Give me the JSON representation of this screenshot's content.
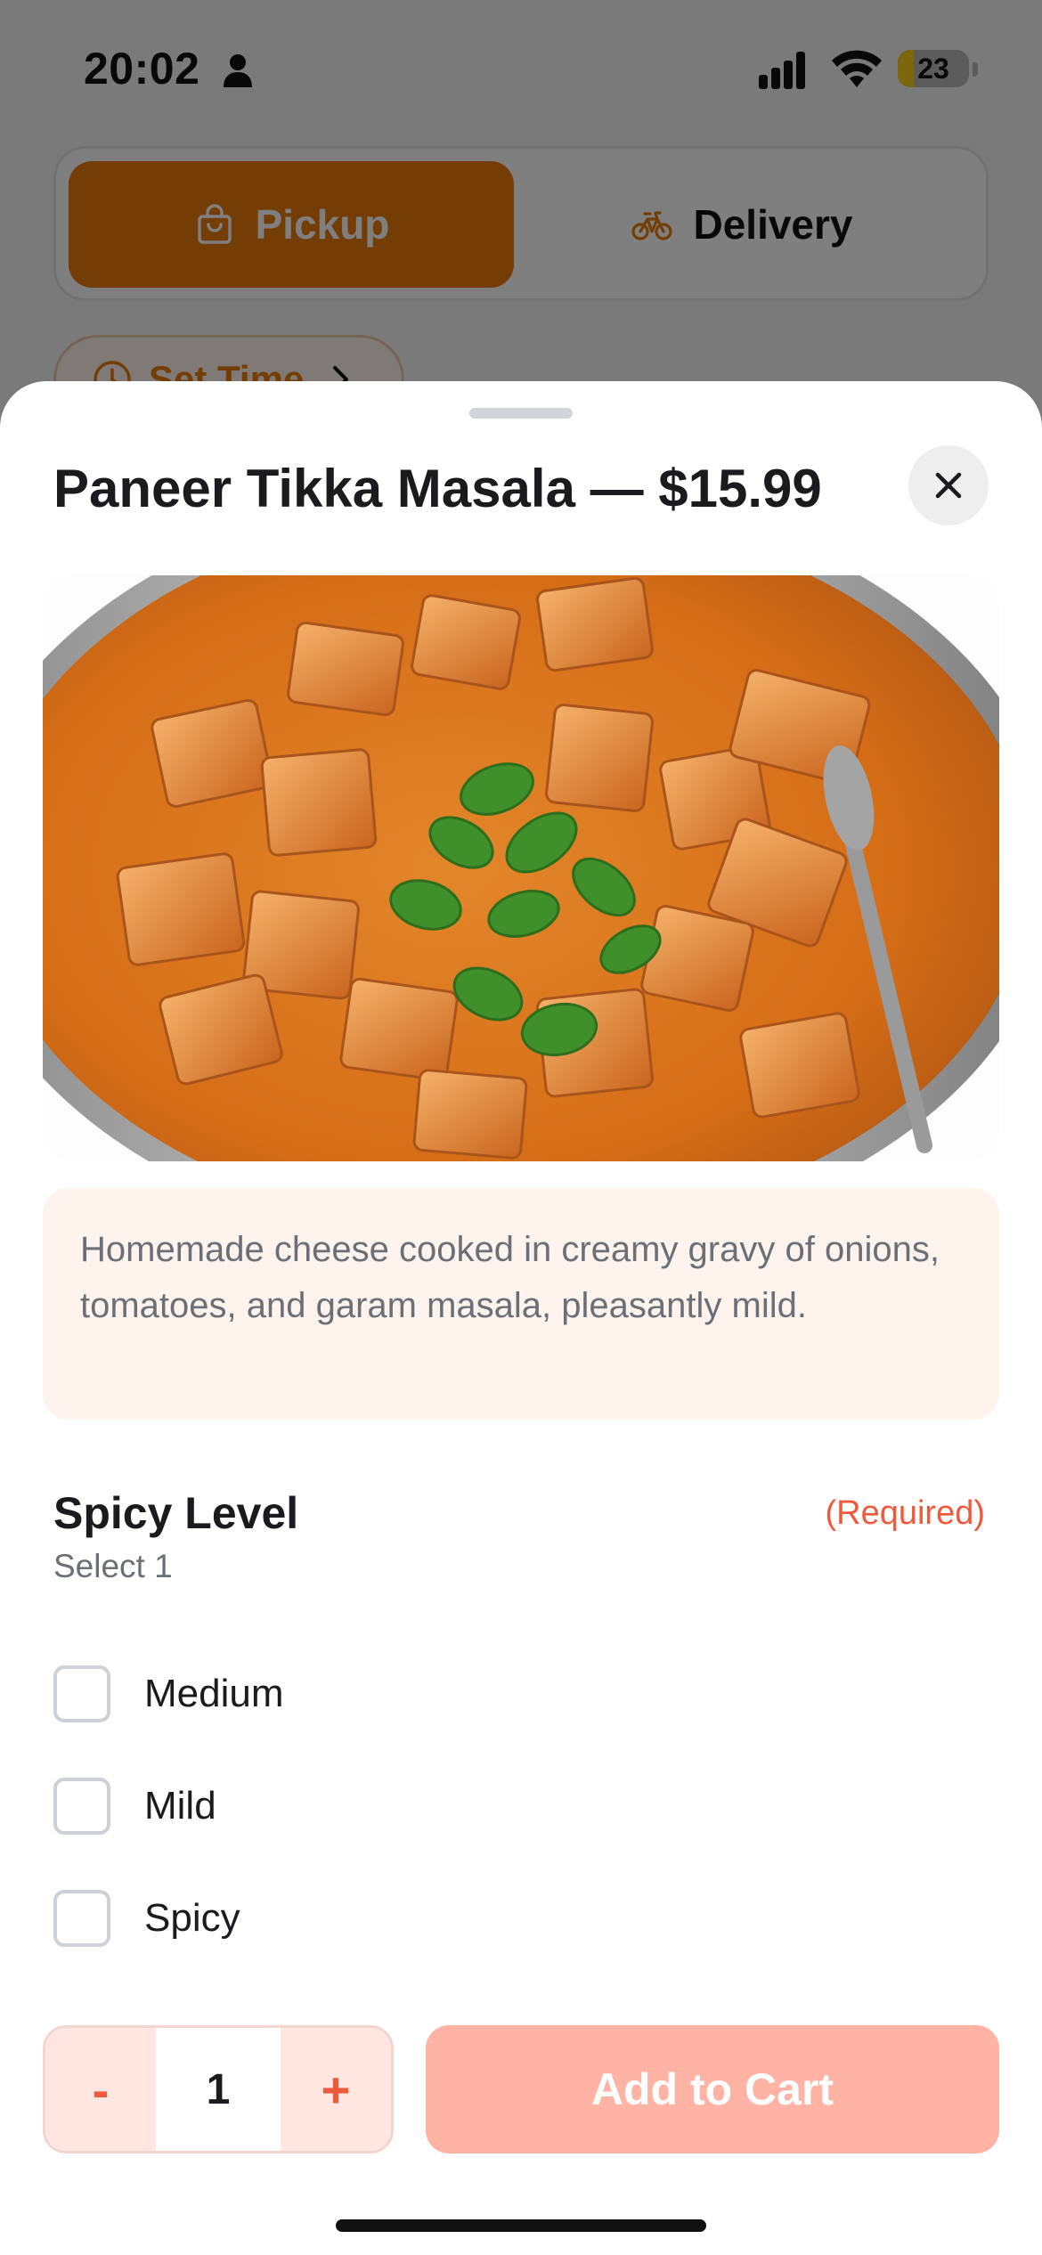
{
  "status_bar": {
    "time": "20:02",
    "battery_level": "23",
    "battery_fraction": 0.23
  },
  "order_mode": {
    "pickup_label": "Pickup",
    "delivery_label": "Delivery",
    "selected": "Pickup"
  },
  "set_time": {
    "label": "Set Time"
  },
  "item": {
    "title": "Paneer Tikka Masala — $15.99",
    "description": "Homemade cheese cooked in creamy gravy of onions, tomatoes, and garam masala, pleasantly mild."
  },
  "option_group": {
    "title": "Spicy Level",
    "required_label": "(Required)",
    "hint": "Select 1",
    "options": [
      {
        "label": "Medium",
        "checked": false
      },
      {
        "label": "Mild",
        "checked": false
      },
      {
        "label": "Spicy",
        "checked": false
      }
    ]
  },
  "footer": {
    "decrement_label": "-",
    "quantity": "1",
    "increment_label": "+",
    "add_to_cart_label": "Add to Cart"
  },
  "colors": {
    "accent_orange": "#e97a0d",
    "required_red": "#ef5a3c",
    "add_to_cart_disabled": "#ffb3a4",
    "description_bg": "#fff3ee"
  },
  "icons": {
    "close": "close-icon",
    "pickup": "shopping-bag-icon",
    "delivery": "bicycle-icon",
    "set_time": "clock-icon",
    "chevron": "chevron-right-icon"
  }
}
